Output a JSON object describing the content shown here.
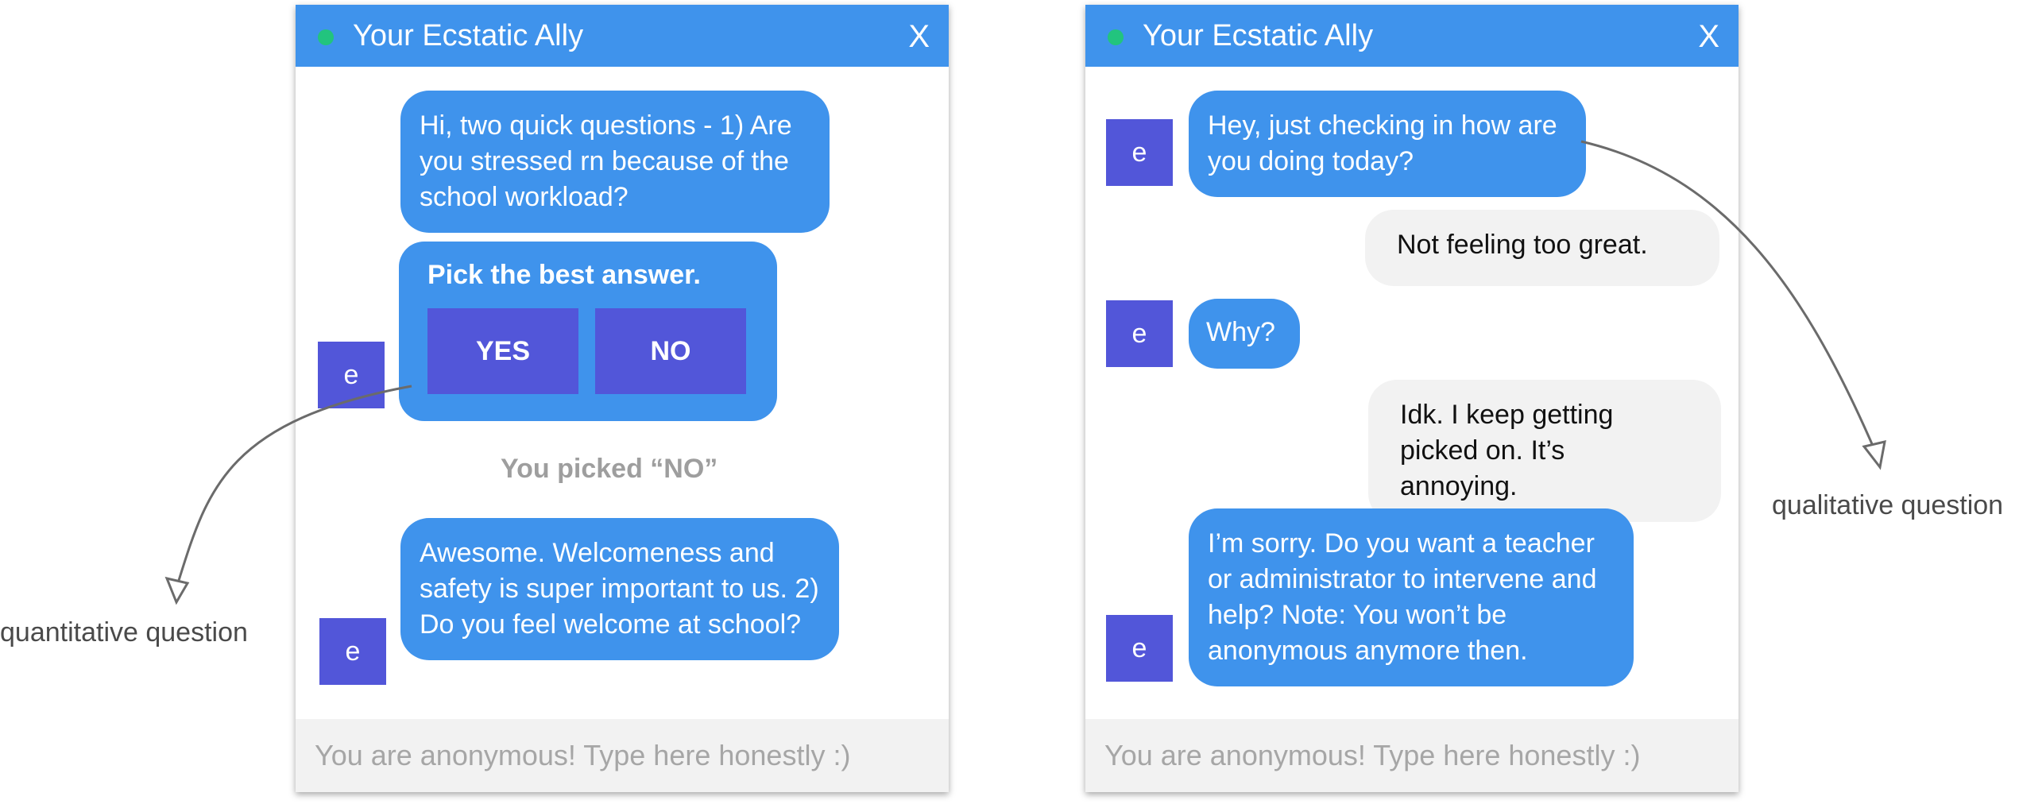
{
  "left_chat": {
    "title": "Your Ecstatic Ally",
    "close_label": "X",
    "messages": {
      "intro_question": "Hi, two quick questions - 1) Are you stressed rn because of the school workload?",
      "answer_prompt": "Pick the best answer.",
      "yes_label": "YES",
      "no_label": "NO",
      "picked_note": "You picked “NO”",
      "followup": "Awesome. Welcomeness and safety is super important to us. 2) Do you feel welcome at school?"
    },
    "avatar_label": "e",
    "input_placeholder": "You are anonymous! Type here honestly :)"
  },
  "right_chat": {
    "title": "Your Ecstatic Ally",
    "close_label": "X",
    "messages": [
      {
        "from": "bot",
        "text": "Hey, just checking in how are you doing today?"
      },
      {
        "from": "user",
        "text": "Not feeling too great."
      },
      {
        "from": "bot",
        "text": "Why?"
      },
      {
        "from": "user",
        "text": "Idk. I keep getting picked on. It’s annoying."
      },
      {
        "from": "bot",
        "text": "I’m sorry. Do you want a teacher or administrator to intervene and help? Note: You won’t be anonymous anymore then."
      }
    ],
    "avatar_label": "e",
    "input_placeholder": "You are anonymous! Type here honestly :)"
  },
  "annotations": {
    "quantitative": "quantitative question",
    "qualitative": "qualitative question"
  },
  "colors": {
    "header": "#3f93ec",
    "bot_bubble": "#3f93ec",
    "avatar": "#5256d9",
    "status_dot": "#22c47e",
    "user_bubble": "#f2f2f2"
  }
}
